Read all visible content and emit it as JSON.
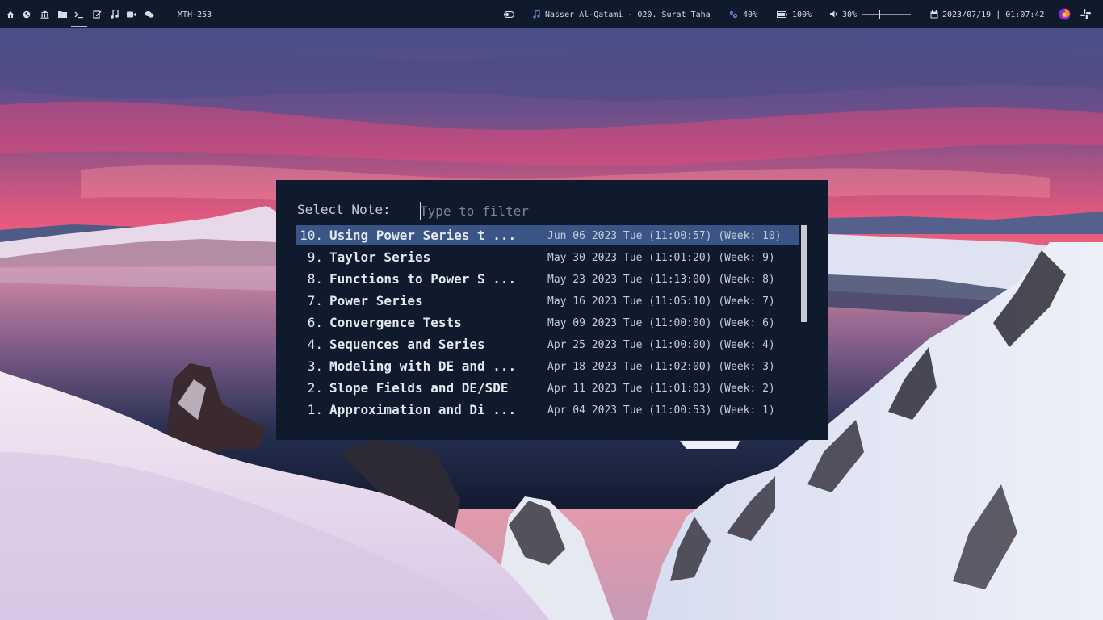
{
  "topbar": {
    "workspaces": [
      {
        "icon": "home-icon",
        "active": false
      },
      {
        "icon": "globe-icon",
        "active": false
      },
      {
        "icon": "bank-icon",
        "active": false
      },
      {
        "icon": "folder-icon",
        "active": false
      },
      {
        "icon": "terminal-icon",
        "active": true
      },
      {
        "icon": "edit-icon",
        "active": false
      },
      {
        "icon": "music-icon",
        "active": false
      },
      {
        "icon": "video-icon",
        "active": false
      },
      {
        "icon": "chat-icon",
        "active": false
      }
    ],
    "window_title": "MTH-253",
    "toggle_icon": "toggle-icon",
    "music_icon": "music-note-icon",
    "now_playing": "Nasser Al-Qatami - 020. Surat Taha",
    "cpu_icon": "cpu-icon",
    "cpu": "40%",
    "battery_icon": "battery-icon",
    "battery": "100%",
    "volume_icon": "volume-icon",
    "volume": "30%",
    "volume_level": 0.35,
    "calendar_icon": "calendar-icon",
    "datetime": "2023/07/19 | 01:07:42",
    "tray": [
      "firefox-icon",
      "slack-icon"
    ]
  },
  "menu": {
    "prompt": "Select Note:",
    "placeholder": "Type to filter",
    "items": [
      {
        "num": "10.",
        "title": "Using Power Series t ...",
        "date": "Jun 06 2023 Tue (11:00:57) (Week: 10)",
        "selected": true
      },
      {
        "num": "9.",
        "title": "Taylor Series",
        "date": "May 30 2023 Tue (11:01:20) (Week: 9)",
        "selected": false
      },
      {
        "num": "8.",
        "title": "Functions to Power S ...",
        "date": "May 23 2023 Tue (11:13:00) (Week: 8)",
        "selected": false
      },
      {
        "num": "7.",
        "title": "Power Series",
        "date": "May 16 2023 Tue (11:05:10) (Week: 7)",
        "selected": false
      },
      {
        "num": "6.",
        "title": "Convergence Tests",
        "date": "May 09 2023 Tue (11:00:00) (Week: 6)",
        "selected": false
      },
      {
        "num": "4.",
        "title": "Sequences and Series",
        "date": "Apr 25 2023 Tue (11:00:00) (Week: 4)",
        "selected": false
      },
      {
        "num": "3.",
        "title": "Modeling with DE and ...",
        "date": "Apr 18 2023 Tue (11:02:00) (Week: 3)",
        "selected": false
      },
      {
        "num": "2.",
        "title": "Slope Fields and DE/SDE",
        "date": "Apr 11 2023 Tue (11:01:03) (Week: 2)",
        "selected": false
      },
      {
        "num": "1.",
        "title": "Approximation and Di ...",
        "date": "Apr 04 2023 Tue (11:00:53) (Week: 1)",
        "selected": false
      }
    ]
  },
  "colors": {
    "bar_bg": "#0f1a2d",
    "popup_bg": "#0f1a2d",
    "selection": "#3a5585",
    "text": "#e3e7ee"
  }
}
